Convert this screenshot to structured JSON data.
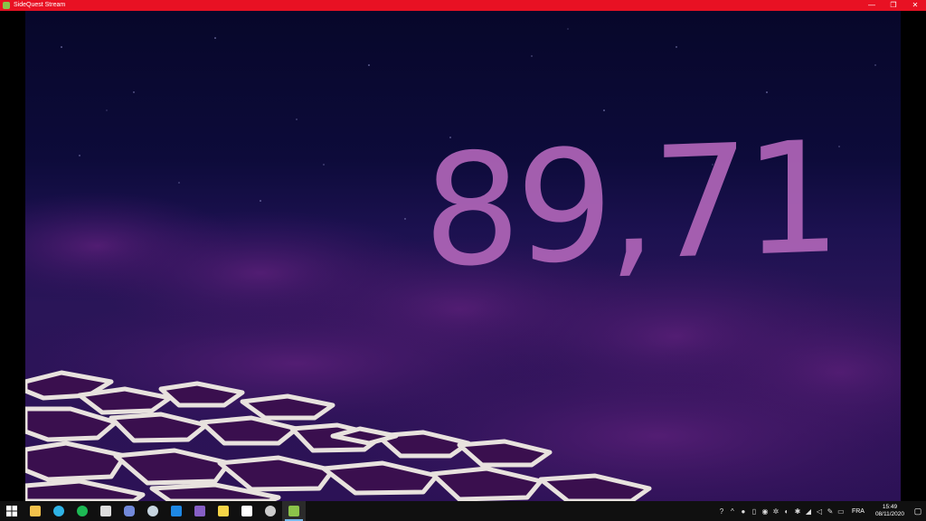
{
  "window": {
    "title": "SideQuest Stream",
    "minimize": "—",
    "restore": "❐",
    "close": "✕"
  },
  "game": {
    "score": "89,71"
  },
  "taskbar": {
    "apps": [
      {
        "name": "start-icon",
        "color": "#ffffff"
      },
      {
        "name": "file-explorer-icon",
        "color": "#f3c14b"
      },
      {
        "name": "edge-icon",
        "color": "#2fb3e6"
      },
      {
        "name": "spotify-icon",
        "color": "#1db954"
      },
      {
        "name": "store-icon",
        "color": "#dddddd"
      },
      {
        "name": "discord-icon",
        "color": "#7289da"
      },
      {
        "name": "steam-icon",
        "color": "#c7d5e0"
      },
      {
        "name": "vscode-icon",
        "color": "#1e88e5"
      },
      {
        "name": "visual-studio-icon",
        "color": "#865fc5"
      },
      {
        "name": "sticky-notes-icon",
        "color": "#f5d547"
      },
      {
        "name": "oculus-icon",
        "color": "#ffffff"
      },
      {
        "name": "unity-icon",
        "color": "#cccccc"
      },
      {
        "name": "android-icon",
        "color": "#8bc34a"
      }
    ],
    "tray": {
      "language": "FRA",
      "time": "15:49",
      "date": "08/11/2020",
      "chevron": "^",
      "notifications": "▢"
    }
  }
}
